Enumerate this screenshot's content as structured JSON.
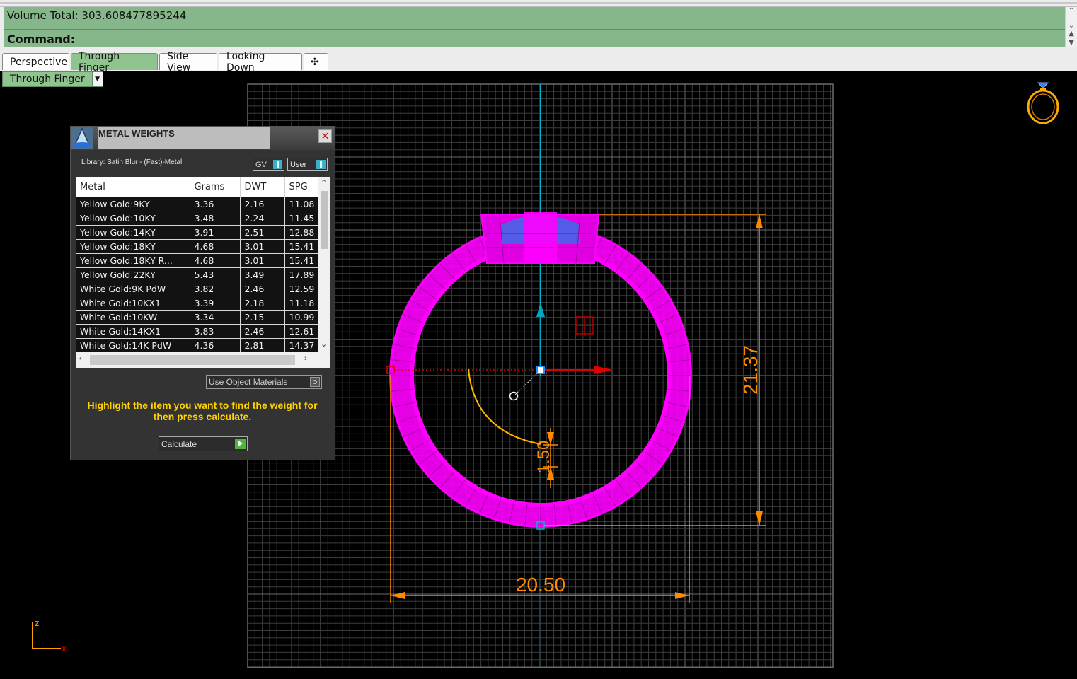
{
  "history": {
    "text": "Volume Total: 303.608477895244"
  },
  "command": {
    "label": "Command:",
    "value": ""
  },
  "tabs": [
    {
      "label": "Perspective",
      "active": false
    },
    {
      "label": "Through Finger",
      "active": true
    },
    {
      "label": "Side View",
      "active": false
    },
    {
      "label": "Looking Down",
      "active": false
    },
    {
      "label": "✣",
      "active": false
    }
  ],
  "viewport": {
    "name": "Through Finger",
    "dimensions": {
      "width": "20.50",
      "height": "21.37",
      "thickness": "1.50"
    },
    "axes": {
      "x": "x",
      "z": "z"
    },
    "colors": {
      "ring": "#ff00ff",
      "dimension": "#ff8a00",
      "x_axis": "#c80000",
      "y_axis": "#00b4c8",
      "grid": "#4a4a4a"
    }
  },
  "panel": {
    "title": "METAL WEIGHTS",
    "close": "✕",
    "library": "Library: Satin Blur - (Fast)-Metal",
    "toggle_gv": "GV",
    "toggle_user": "User",
    "columns": [
      "Metal",
      "Grams",
      "DWT",
      "SPG"
    ],
    "rows": [
      [
        "Yellow Gold:9KY",
        "3.36",
        "2.16",
        "11.08"
      ],
      [
        "Yellow Gold:10KY",
        "3.48",
        "2.24",
        "11.45"
      ],
      [
        "Yellow Gold:14KY",
        "3.91",
        "2.51",
        "12.88"
      ],
      [
        "Yellow Gold:18KY",
        "4.68",
        "3.01",
        "15.41"
      ],
      [
        "Yellow Gold:18KY R...",
        "4.68",
        "3.01",
        "15.41"
      ],
      [
        "Yellow Gold:22KY",
        "5.43",
        "3.49",
        "17.89"
      ],
      [
        "White Gold:9K PdW",
        "3.82",
        "2.46",
        "12.59"
      ],
      [
        "White Gold:10KX1",
        "3.39",
        "2.18",
        "11.18"
      ],
      [
        "White Gold:10KW",
        "3.34",
        "2.15",
        "10.99"
      ],
      [
        "White Gold:14KX1",
        "3.83",
        "2.46",
        "12.61"
      ],
      [
        "White Gold:14K PdW",
        "4.36",
        "2.81",
        "14.37"
      ]
    ],
    "use_object_materials": "Use Object Materials",
    "instruction": "Highlight the item you want to find the weight for then press calculate.",
    "calculate": "Calculate"
  }
}
